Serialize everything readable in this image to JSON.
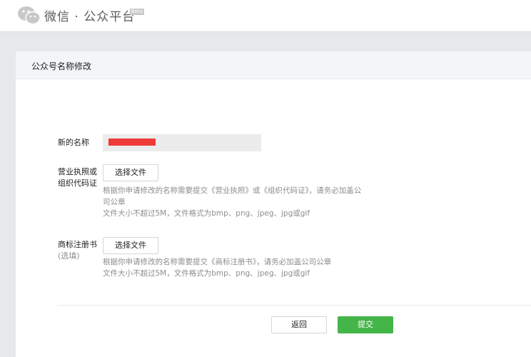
{
  "header": {
    "brand_title": "微信 · 公众平台",
    "beta_badge": "Beta",
    "logo_icon": "wechat-logo-icon"
  },
  "panel": {
    "title": "公众号名称修改"
  },
  "form": {
    "new_name": {
      "label": "新的名称",
      "value_redacted": true,
      "redaction_color": "#f03a3a"
    },
    "business_license": {
      "label_line1": "营业执照或",
      "label_line2": "组织代码证",
      "button_label": "选择文件",
      "hint_line1": "根据你申请修改的名称需要提交《营业执照》或《组织代码证》，请务必加盖公",
      "hint_line2": "司公章",
      "hint_line3": "文件大小不超过5M，文件格式为bmp、png、jpeg、jpg或gif"
    },
    "trademark": {
      "label": "商标注册书",
      "label_sub": "(选填)",
      "button_label": "选择文件",
      "hint_line1": "根据你申请修改的名称需要提交《商标注册书》，请务必加盖公司公章",
      "hint_line2": "文件大小不超过5M，文件格式为bmp、png、jpeg、jpg或gif"
    }
  },
  "actions": {
    "back_label": "返回",
    "submit_label": "提交",
    "submit_color": "#44b549"
  }
}
